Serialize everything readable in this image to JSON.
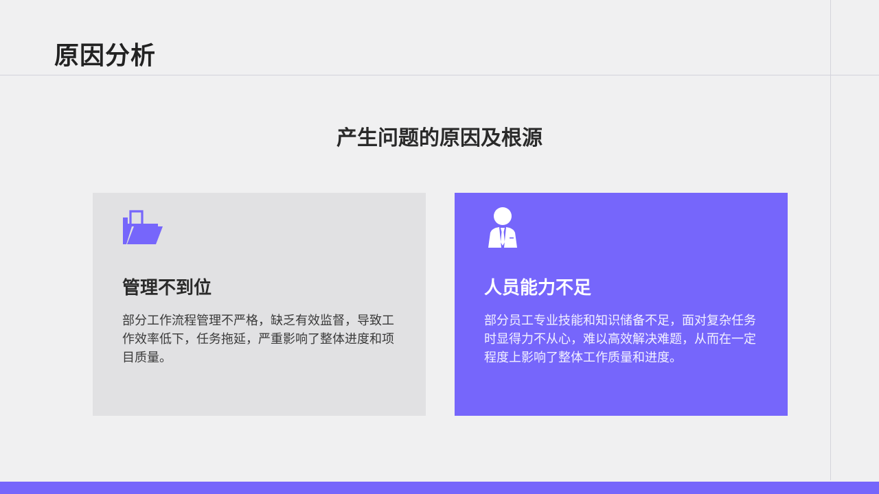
{
  "header": {
    "title": "原因分析"
  },
  "main": {
    "subtitle": "产生问题的原因及根源",
    "cards": [
      {
        "icon": "folder-icon",
        "title": "管理不到位",
        "body": "部分工作流程管理不严格，缺乏有效监督，导致工作效率低下，任务拖延，严重影响了整体进度和项目质量。"
      },
      {
        "icon": "business-person-icon",
        "title": "人员能力不足",
        "body": "部分员工专业技能和知识储备不足，面对复杂任务时显得力不从心，难以高效解决难题，从而在一定程度上影响了整体工作质量和进度。"
      }
    ]
  },
  "colors": {
    "accent": "#7666fb",
    "background": "#f0f0f1",
    "card_gray": "#e1e1e3"
  }
}
